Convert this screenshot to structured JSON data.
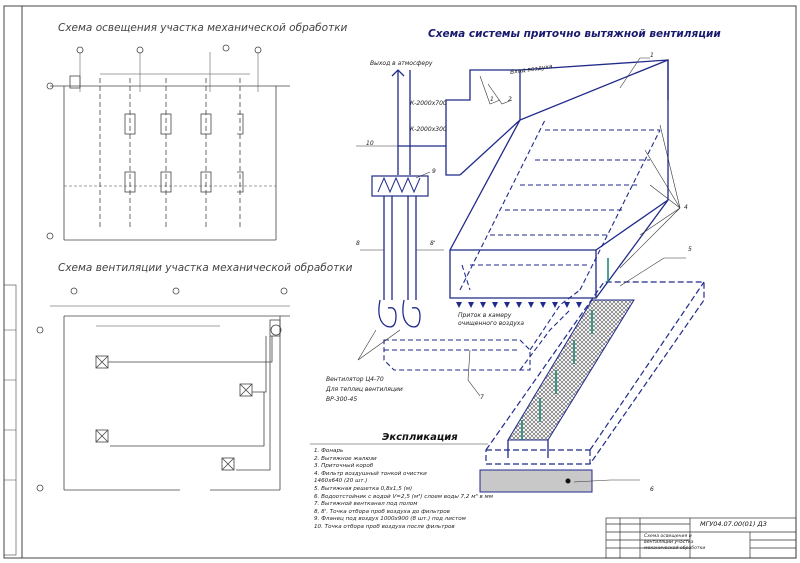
{
  "lighting": {
    "title": "Схема освещения участка механической обработки"
  },
  "ventilation": {
    "title": "Схема вентиляции участка механической обработки"
  },
  "system": {
    "title": "Схема системы приточно вытяжной вентиляции",
    "labels": {
      "exhaust": "Выход в атмосферу",
      "intake": "Вход воздуха",
      "duct1": "К-2000х700",
      "duct2": "К-2000х300",
      "fan1": "Вентилятор Ц4-70",
      "fan2": "Для теплиц вентиляции",
      "fan3": "ВР-300-45",
      "inflow1": "Приток в камеру",
      "inflow2": "очищенного воздуха"
    },
    "callouts": [
      "1",
      "2",
      "3",
      "4",
      "5",
      "6",
      "7",
      "8",
      "8'",
      "9",
      "10"
    ]
  },
  "legend": {
    "title": "Экспликация",
    "items": [
      "1. Фонарь",
      "2. Вытяжное жалюзи",
      "3. Приточный короб",
      "4. Фильтр воздушный тонкой очистки",
      "1460х640 (20 шт.)",
      "5. Вытяжная решетка 0,8х1,5 (м)",
      "6. Водоотстойник с водой V=2,5 (м³) слоем воды 7,2 м³ в мм",
      "7. Вытяжной вентканал под полом",
      "8, 8'. Точка отбора проб воздуха до фильтров",
      "9. Фланец под воздух 1000х900 (8 шт.) под листом",
      "10. Точка отбора проб воздуха после фильтров"
    ]
  },
  "stamp": {
    "code": "МГУ04.07.00(01) ДЗ",
    "name1": "Схема освещения и",
    "name2": "вентиляции участка",
    "name3": "механической обработки"
  }
}
